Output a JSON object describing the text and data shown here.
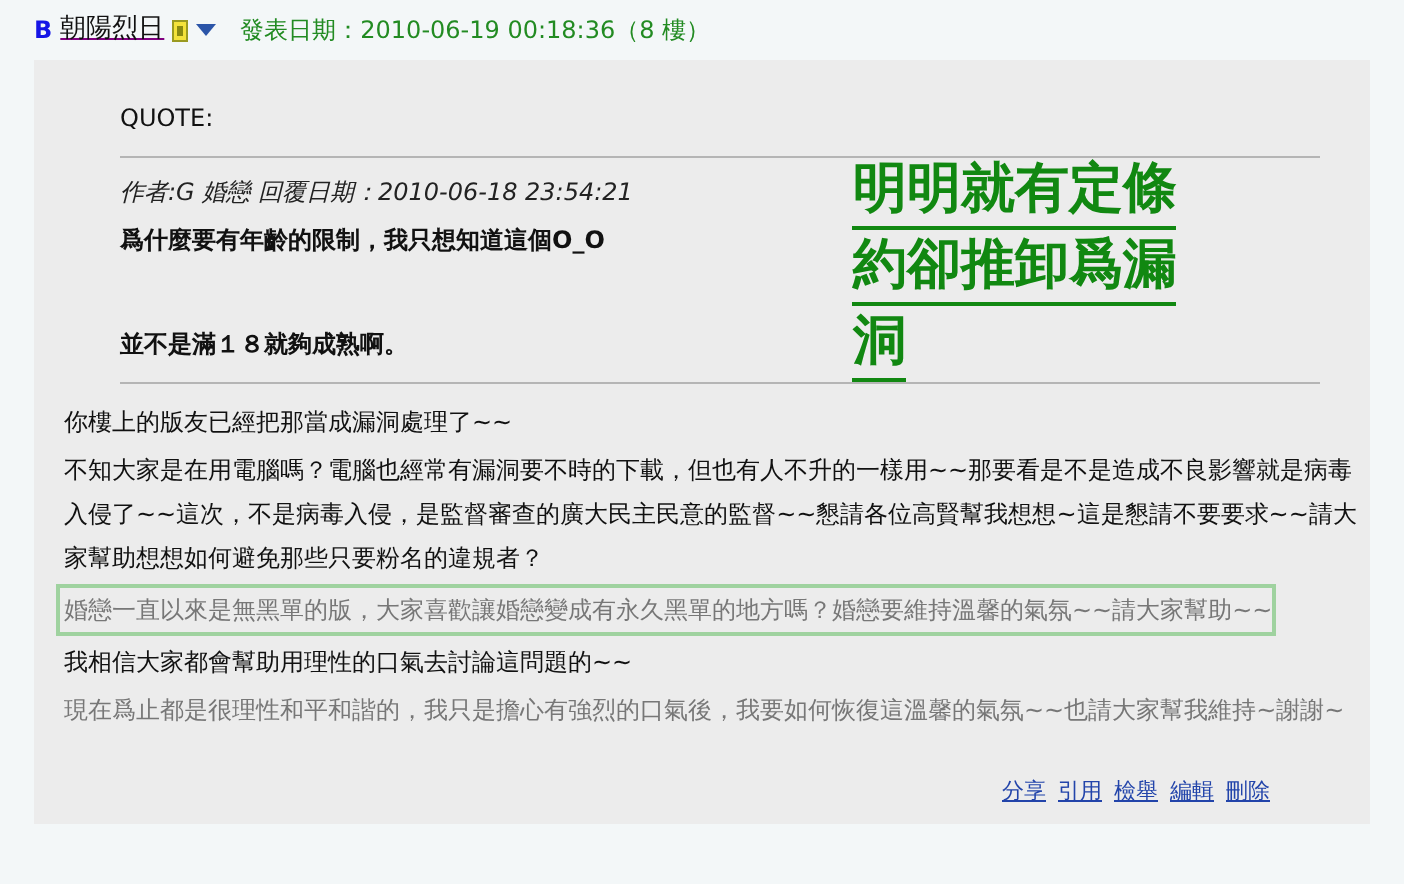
{
  "header": {
    "prefix": "B",
    "author": "朝陽烈日",
    "posted": "發表日期：2010-06-19 00:18:36（8 樓）"
  },
  "quote": {
    "label": "QUOTE:",
    "byline": "作者:G 婚戀 回覆日期：2010-06-18 23:54:21",
    "question": "爲什麼要有年齡的限制，我只想知道這個O_O",
    "remark": "並不是滿１８就夠成熟啊。",
    "callout_lines": [
      "明明就有定條",
      "約卻推卸爲漏",
      "洞"
    ]
  },
  "paragraphs": [
    {
      "kind": "plain",
      "text": "你樓上的版友已經把那當成漏洞處理了~~"
    },
    {
      "kind": "plain",
      "text": "不知大家是在用電腦嗎？電腦也經常有漏洞要不時的下載，但也有人不升的一樣用~~那要看是不是造成不良影響就是病毒入侵了~~這次，不是病毒入侵，是監督審查的廣大民主民意的監督~~懇請各位高賢幫我想想~這是懇請不要要求~~請大家幫助想想如何避免那些只要粉名的違規者？"
    },
    {
      "kind": "boxed",
      "text": "婚戀一直以來是無黑單的版，大家喜歡讓婚戀變成有永久黑單的地方嗎？婚戀要維持溫馨的氣氛~~請大家幫助~~"
    },
    {
      "kind": "plain",
      "text": "我相信大家都會幫助用理性的口氣去討論這問題的~~"
    },
    {
      "kind": "muted",
      "text": "現在爲止都是很理性和平和諧的，我只是擔心有強烈的口氣後，我要如何恢復這溫馨的氣氛~~也請大家幫我維持~謝謝~"
    }
  ],
  "actions": [
    "分享",
    "引用",
    "檢舉",
    "編輯",
    "刪除"
  ]
}
